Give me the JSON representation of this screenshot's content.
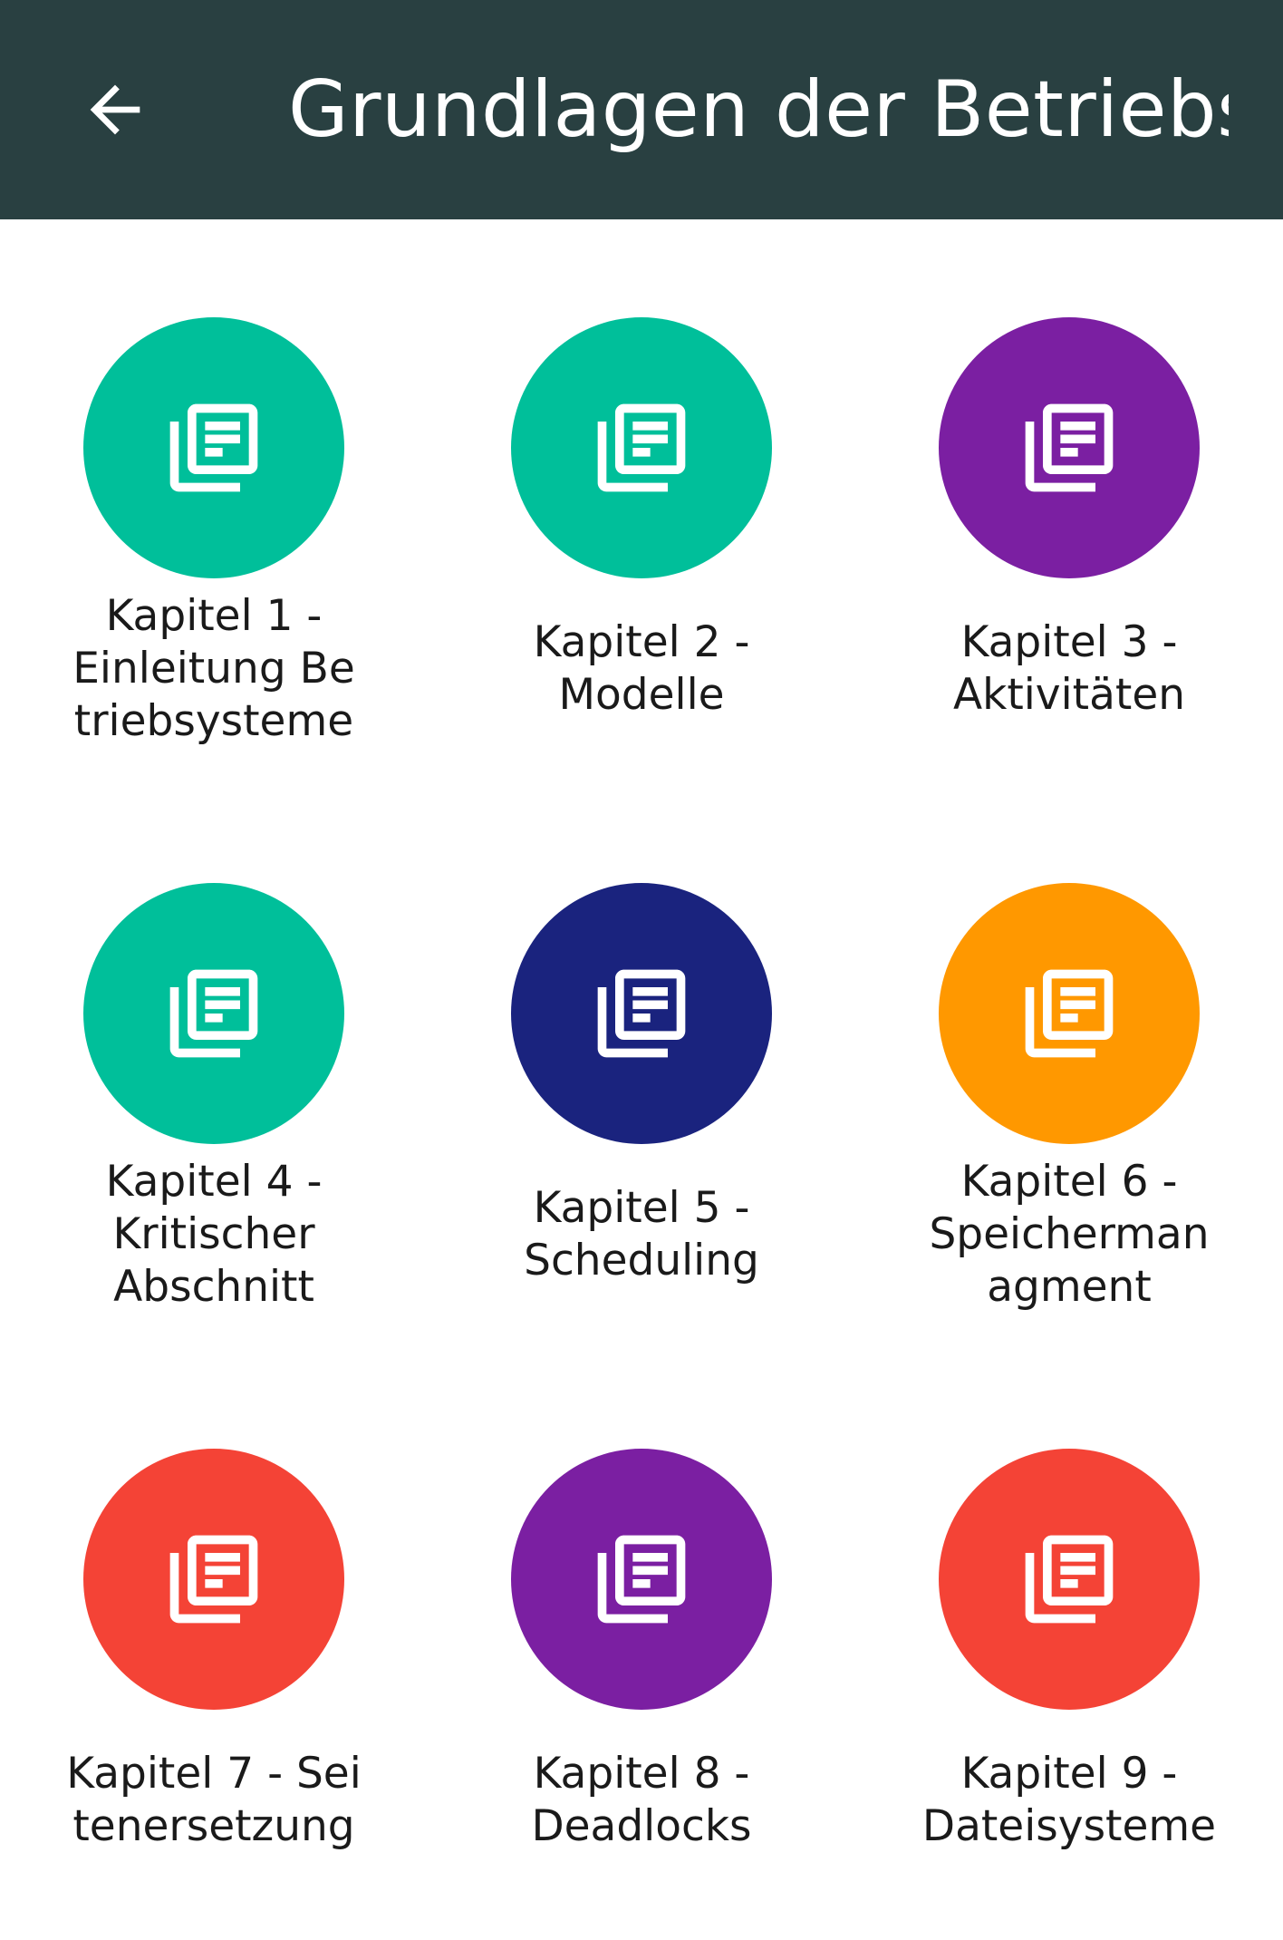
{
  "header": {
    "title": "Grundlagen der Betriebs...",
    "background": "#294041",
    "back_icon": "arrow-left-icon"
  },
  "chapters": [
    {
      "lines": [
        "Kapitel 1 -",
        "Einleitung Be",
        "triebsysteme"
      ],
      "color": "#00BF9A",
      "icon": "library-books-icon"
    },
    {
      "lines": [
        "Kapitel 2 -",
        "Modelle"
      ],
      "color": "#00BF9A",
      "icon": "library-books-icon"
    },
    {
      "lines": [
        "Kapitel 3 -",
        "Aktivitäten"
      ],
      "color": "#7B1FA2",
      "icon": "library-books-icon"
    },
    {
      "lines": [
        "Kapitel 4 -",
        "Kritischer",
        "Abschnitt"
      ],
      "color": "#00BF9A",
      "icon": "library-books-icon"
    },
    {
      "lines": [
        "Kapitel 5 -",
        "Scheduling"
      ],
      "color": "#1A237E",
      "icon": "library-books-icon"
    },
    {
      "lines": [
        "Kapitel 6 -",
        "Speicherman",
        "agment"
      ],
      "color": "#FF9800",
      "icon": "library-books-icon"
    },
    {
      "lines": [
        "Kapitel 7 - Sei",
        "tenersetzung"
      ],
      "color": "#F44336",
      "icon": "library-books-icon"
    },
    {
      "lines": [
        "Kapitel 8 -",
        "Deadlocks"
      ],
      "color": "#7B1FA2",
      "icon": "library-books-icon"
    },
    {
      "lines": [
        "Kapitel 9 -",
        "Dateisysteme"
      ],
      "color": "#F44336",
      "icon": "library-books-icon"
    }
  ]
}
